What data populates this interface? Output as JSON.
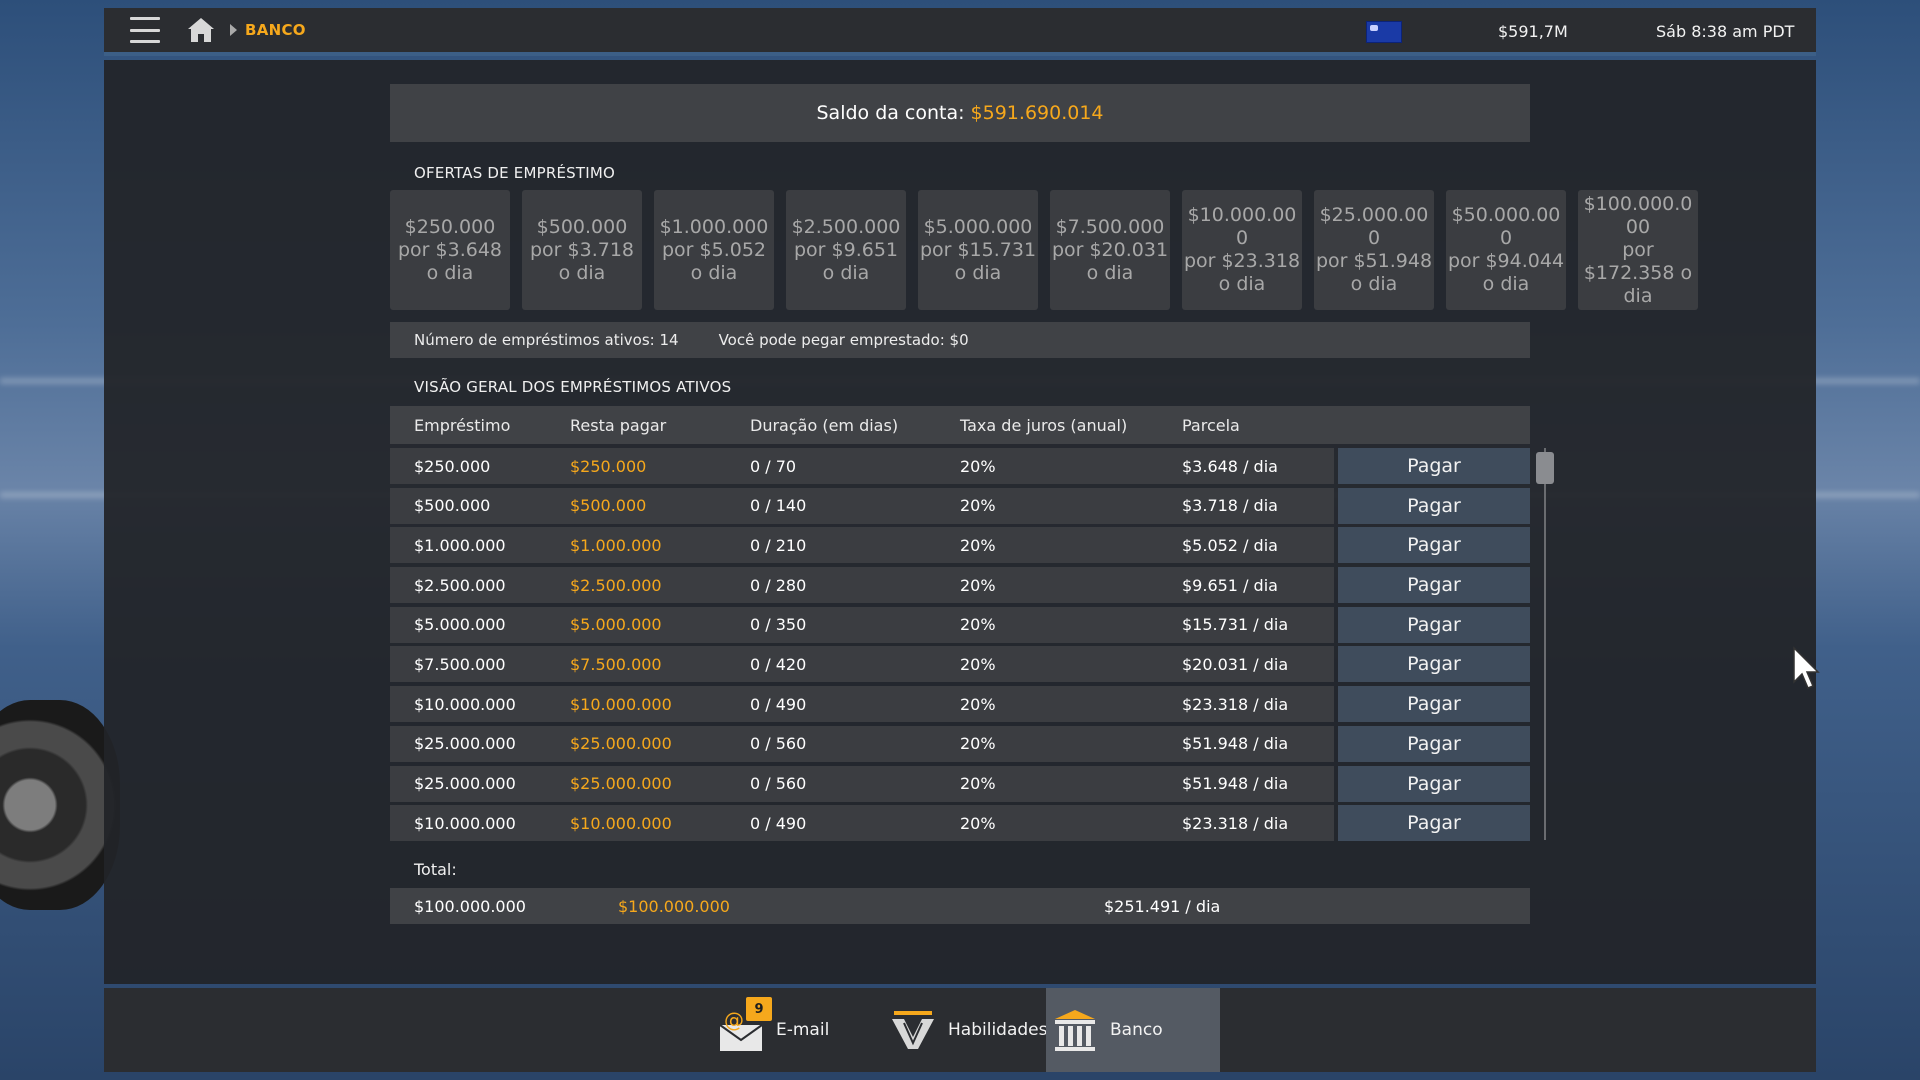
{
  "header": {
    "breadcrumb": "BANCO",
    "money": "$591,7M",
    "time": "Sáb 8:38 am PDT"
  },
  "balance": {
    "label": "Saldo da conta:",
    "value": "$591.690.014"
  },
  "offers": {
    "title": "OFERTAS DE EMPRÉSTIMO",
    "items": [
      {
        "amount": "$250.000",
        "daily": "por $3.648 o dia"
      },
      {
        "amount": "$500.000",
        "daily": "por $3.718 o dia"
      },
      {
        "amount": "$1.000.000",
        "daily": "por $5.052 o dia"
      },
      {
        "amount": "$2.500.000",
        "daily": "por $9.651 o dia"
      },
      {
        "amount": "$5.000.000",
        "daily": "por $15.731 o dia"
      },
      {
        "amount": "$7.500.000",
        "daily": "por $20.031 o dia"
      },
      {
        "amount": "$10.000.000",
        "daily": "por $23.318 o dia"
      },
      {
        "amount": "$25.000.000",
        "daily": "por $51.948 o dia"
      },
      {
        "amount": "$50.000.000",
        "daily": "por $94.044 o dia"
      },
      {
        "amount": "$100.000.000",
        "daily": "por $172.358 o dia"
      }
    ]
  },
  "info": {
    "active_loans": "Número de empréstimos ativos: 14",
    "can_borrow": "Você pode pegar emprestado: $0"
  },
  "overview": {
    "title": "VISÃO GERAL DOS EMPRÉSTIMOS ATIVOS",
    "columns": [
      "Empréstimo",
      "Resta pagar",
      "Duração (em dias)",
      "Taxa de juros (anual)",
      "Parcela"
    ],
    "pay_label": "Pagar",
    "rows": [
      {
        "loan": "$250.000",
        "remaining": "$250.000",
        "duration": "0 / 70",
        "rate": "20%",
        "installment": "$3.648 / dia"
      },
      {
        "loan": "$500.000",
        "remaining": "$500.000",
        "duration": "0 / 140",
        "rate": "20%",
        "installment": "$3.718 / dia"
      },
      {
        "loan": "$1.000.000",
        "remaining": "$1.000.000",
        "duration": "0 / 210",
        "rate": "20%",
        "installment": "$5.052 / dia"
      },
      {
        "loan": "$2.500.000",
        "remaining": "$2.500.000",
        "duration": "0 / 280",
        "rate": "20%",
        "installment": "$9.651 / dia"
      },
      {
        "loan": "$5.000.000",
        "remaining": "$5.000.000",
        "duration": "0 / 350",
        "rate": "20%",
        "installment": "$15.731 / dia"
      },
      {
        "loan": "$7.500.000",
        "remaining": "$7.500.000",
        "duration": "0 / 420",
        "rate": "20%",
        "installment": "$20.031 / dia"
      },
      {
        "loan": "$10.000.000",
        "remaining": "$10.000.000",
        "duration": "0 / 490",
        "rate": "20%",
        "installment": "$23.318 / dia"
      },
      {
        "loan": "$25.000.000",
        "remaining": "$25.000.000",
        "duration": "0 / 560",
        "rate": "20%",
        "installment": "$51.948 / dia"
      },
      {
        "loan": "$25.000.000",
        "remaining": "$25.000.000",
        "duration": "0 / 560",
        "rate": "20%",
        "installment": "$51.948 / dia"
      },
      {
        "loan": "$10.000.000",
        "remaining": "$10.000.000",
        "duration": "0 / 490",
        "rate": "20%",
        "installment": "$23.318 / dia"
      }
    ]
  },
  "total": {
    "label": "Total:",
    "loan": "$100.000.000",
    "remaining": "$100.000.000",
    "installment": "$251.491 / dia"
  },
  "bottom_tabs": {
    "email": {
      "label": "E-mail",
      "badge": "9"
    },
    "skills": {
      "label": "Habilidades"
    },
    "bank": {
      "label": "Banco"
    }
  },
  "colors": {
    "accent": "#f6a81c",
    "panel": "#222428",
    "row": "#3b3d41",
    "pay_button": "#3f4c5c",
    "active_tab": "#545a63"
  }
}
